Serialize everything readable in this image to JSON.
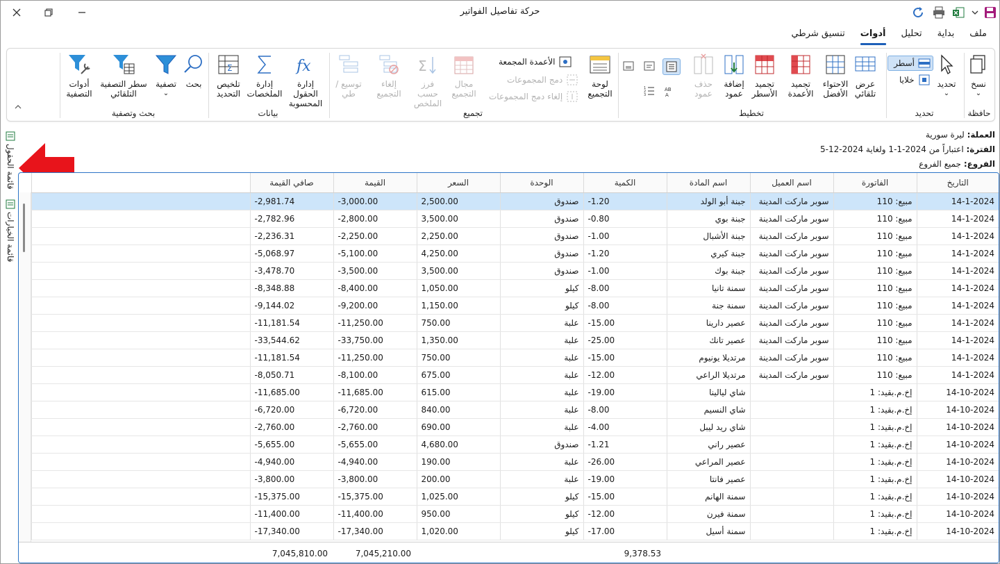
{
  "window": {
    "title": "حركة تفاصيل الفواتير"
  },
  "ribbon_tabs": [
    "ملف",
    "بداية",
    "تحليل",
    "أدوات",
    "تنسيق شرطي"
  ],
  "active_tab": "أدوات",
  "groups": {
    "clipboard": {
      "name": "حافظة",
      "copy": "نسخ"
    },
    "select": {
      "name": "تحديد",
      "select": "تحديد",
      "rows": "أسطر",
      "cells": "خلايا"
    },
    "layout": {
      "name": "تخطيط",
      "auto_fit": "عرض تلقائي",
      "best_fit": "الاحتواء الأفضل",
      "freeze_columns": "تجميد الأعمدة",
      "freeze_rows": "تجميد الأسطر",
      "add_column": "إضافة عمود",
      "delete_column": "حذف عمود"
    },
    "grouping": {
      "name": "تجميع",
      "group_panel": "لوحة التجميع",
      "grouped_columns": "الأعمدة المجمعة",
      "merge_groups": "دمج المجموعات",
      "unmerge_groups": "إلغاء دمج المجموعات",
      "group_range": "مجال التجميع",
      "sort_by_summary": "فرز حسب الملخص",
      "ungroup": "إلغاء التجميع",
      "expand_collapse": "توسيع / طي"
    },
    "data": {
      "name": "بيانات",
      "calc_fields": "إدارة الحقول المحسوبة",
      "manage_summaries": "إدارة الملخصات",
      "selection_summary": "تلخيص التحديد"
    },
    "search_filter": {
      "name": "بحث وتصفية",
      "search": "بحث",
      "filter": "تصفية",
      "auto_filter_row": "سطر التصفية التلقائي",
      "filter_tools": "أدوات التصفية"
    }
  },
  "side_panes": {
    "fields_list": "قائمة الحقول",
    "options_list": "قائمة الخيارات"
  },
  "info": {
    "currency_label": "العملة:",
    "currency": "ليرة سورية",
    "period_label": "الفترة:",
    "period": "اعتباراً من 2024-1-1 ولغاية 2024-12-5",
    "branches_label": "الفروع:",
    "branches": "جميع الفروع"
  },
  "columns": [
    "التاريخ",
    "الفاتورة",
    "اسم العميل",
    "اسم المادة",
    "الكمية",
    "الوحدة",
    "السعر",
    "القيمة",
    "صافي القيمة"
  ],
  "rows": [
    [
      "14-1-2024",
      "مبيع: 110",
      "سوبر ماركت المدينة",
      "جبنة أبو الولد",
      "-1.20",
      "صندوق",
      "2,500.00",
      "-3,000.00",
      "-2,981.74"
    ],
    [
      "14-1-2024",
      "مبيع: 110",
      "سوبر ماركت المدينة",
      "جبنة بوي",
      "-0.80",
      "صندوق",
      "3,500.00",
      "-2,800.00",
      "-2,782.96"
    ],
    [
      "14-1-2024",
      "مبيع: 110",
      "سوبر ماركت المدينة",
      "جبنة الأشبال",
      "-1.00",
      "صندوق",
      "2,250.00",
      "-2,250.00",
      "-2,236.31"
    ],
    [
      "14-1-2024",
      "مبيع: 110",
      "سوبر ماركت المدينة",
      "جبنة كيري",
      "-1.20",
      "صندوق",
      "4,250.00",
      "-5,100.00",
      "-5,068.97"
    ],
    [
      "14-1-2024",
      "مبيع: 110",
      "سوبر ماركت المدينة",
      "جبنة بوك",
      "-1.00",
      "صندوق",
      "3,500.00",
      "-3,500.00",
      "-3,478.70"
    ],
    [
      "14-1-2024",
      "مبيع: 110",
      "سوبر ماركت المدينة",
      "سمنة تانيا",
      "-8.00",
      "كيلو",
      "1,050.00",
      "-8,400.00",
      "-8,348.88"
    ],
    [
      "14-1-2024",
      "مبيع: 110",
      "سوبر ماركت المدينة",
      "سمنة جنة",
      "-8.00",
      "كيلو",
      "1,150.00",
      "-9,200.00",
      "-9,144.02"
    ],
    [
      "14-1-2024",
      "مبيع: 110",
      "سوبر ماركت المدينة",
      "عصير دارينا",
      "-15.00",
      "علبة",
      "750.00",
      "-11,250.00",
      "-11,181.54"
    ],
    [
      "14-1-2024",
      "مبيع: 110",
      "سوبر ماركت المدينة",
      "عصير تانك",
      "-25.00",
      "علبة",
      "1,350.00",
      "-33,750.00",
      "-33,544.62"
    ],
    [
      "14-1-2024",
      "مبيع: 110",
      "سوبر ماركت المدينة",
      "مرتديلا يونيوم",
      "-15.00",
      "علبة",
      "750.00",
      "-11,250.00",
      "-11,181.54"
    ],
    [
      "14-1-2024",
      "مبيع: 110",
      "سوبر ماركت المدينة",
      "مرتديلا الراعي",
      "-12.00",
      "علبة",
      "675.00",
      "-8,100.00",
      "-8,050.71"
    ],
    [
      "14-10-2024",
      "إخ.م.بقيد: 1",
      "",
      "شاي ليالينا",
      "-19.00",
      "علبة",
      "615.00",
      "-11,685.00",
      "-11,685.00"
    ],
    [
      "14-10-2024",
      "إخ.م.بقيد: 1",
      "",
      "شاي النسيم",
      "-8.00",
      "علبة",
      "840.00",
      "-6,720.00",
      "-6,720.00"
    ],
    [
      "14-10-2024",
      "إخ.م.بقيد: 1",
      "",
      "شاي ريد ليبل",
      "-4.00",
      "علبة",
      "690.00",
      "-2,760.00",
      "-2,760.00"
    ],
    [
      "14-10-2024",
      "إخ.م.بقيد: 1",
      "",
      "عصير راني",
      "-1.21",
      "صندوق",
      "4,680.00",
      "-5,655.00",
      "-5,655.00"
    ],
    [
      "14-10-2024",
      "إخ.م.بقيد: 1",
      "",
      "عصير المراعي",
      "-26.00",
      "علبة",
      "190.00",
      "-4,940.00",
      "-4,940.00"
    ],
    [
      "14-10-2024",
      "إخ.م.بقيد: 1",
      "",
      "عصير فانتا",
      "-19.00",
      "علبة",
      "200.00",
      "-3,800.00",
      "-3,800.00"
    ],
    [
      "14-10-2024",
      "إخ.م.بقيد: 1",
      "",
      "سمنة الهانم",
      "-15.00",
      "كيلو",
      "1,025.00",
      "-15,375.00",
      "-15,375.00"
    ],
    [
      "14-10-2024",
      "إخ.م.بقيد: 1",
      "",
      "سمنة فيرن",
      "-12.00",
      "كيلو",
      "950.00",
      "-11,400.00",
      "-11,400.00"
    ],
    [
      "14-10-2024",
      "إخ.م.بقيد: 1",
      "",
      "سمنة أسيل",
      "-17.00",
      "كيلو",
      "1,020.00",
      "-17,340.00",
      "-17,340.00"
    ]
  ],
  "totals": {
    "quantity": "9,378.53",
    "value": "7,045,210.00",
    "net_value": "7,045,810.00"
  },
  "colors": {
    "accent": "#1d5fb8",
    "selected_row": "#cde5fa",
    "arrow": "#e8141b"
  }
}
